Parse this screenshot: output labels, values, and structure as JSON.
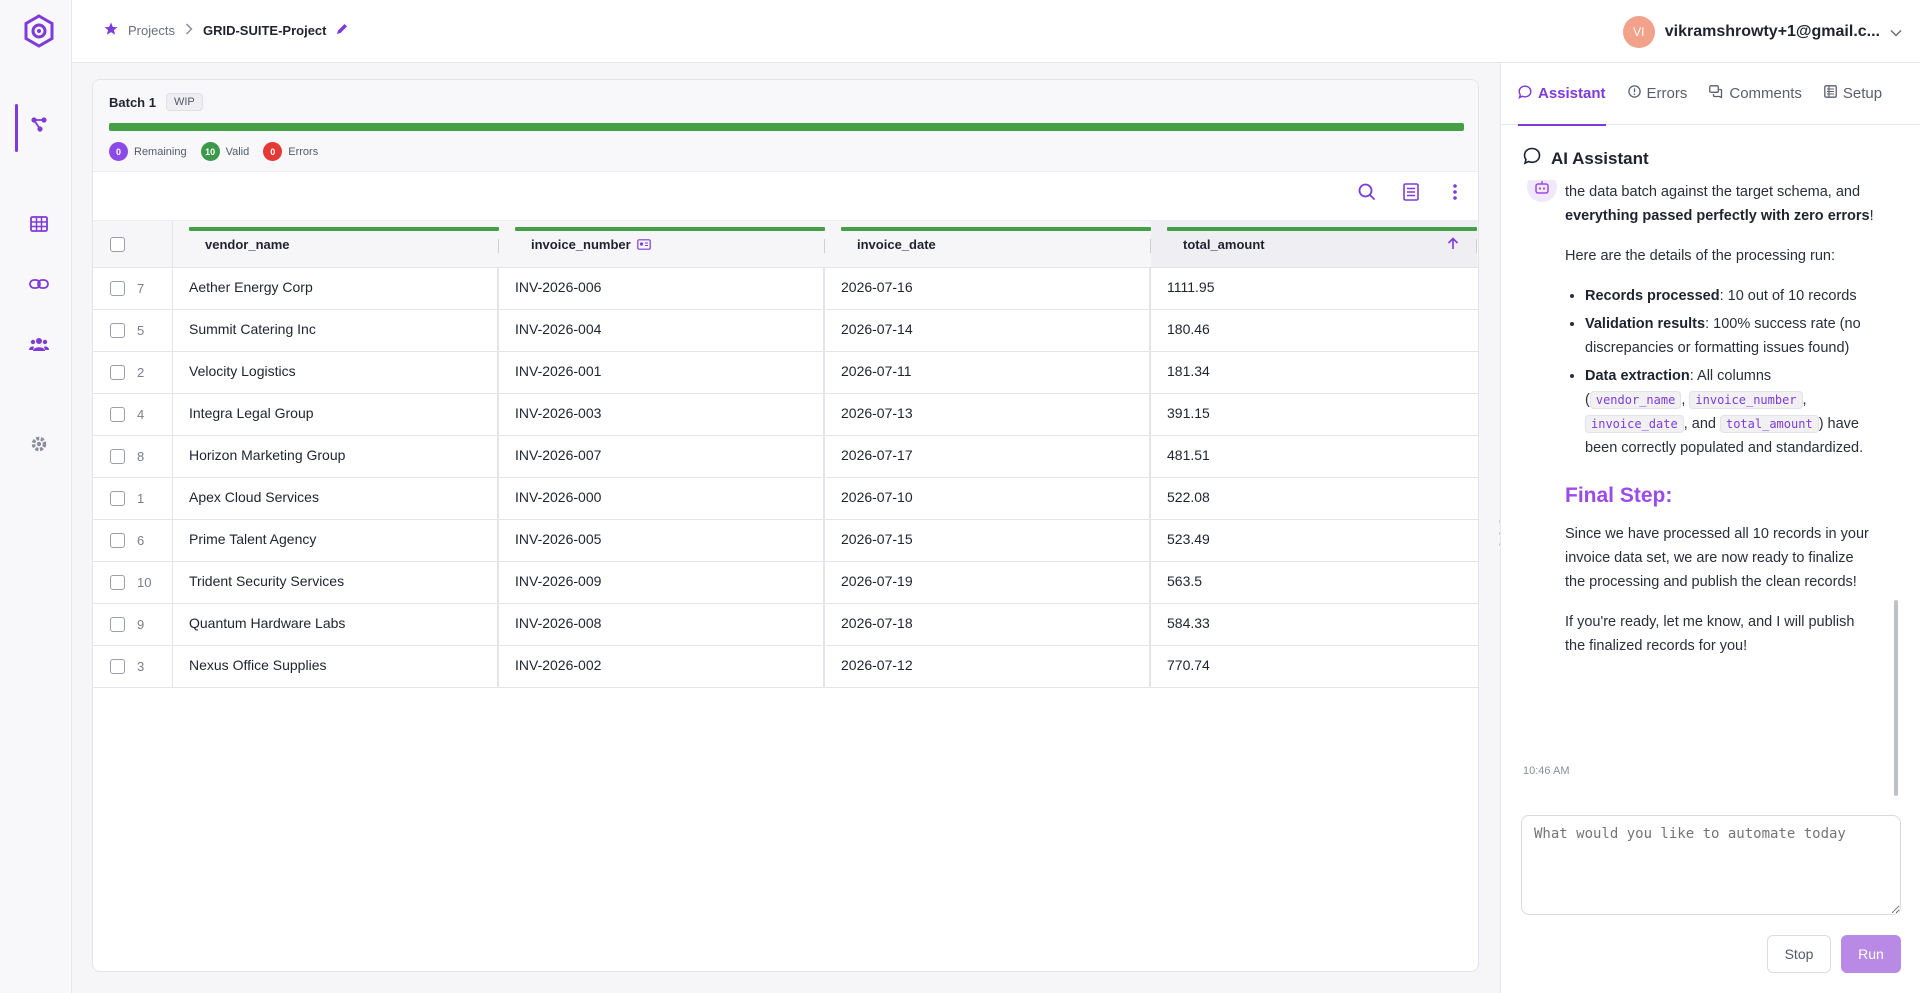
{
  "header": {
    "crumbs": {
      "projects": "Projects",
      "current": "GRID-SUITE-Project"
    },
    "user": {
      "initials": "VI",
      "name": "vikramshrowty+1@gmail.c..."
    }
  },
  "batch": {
    "title": "Batch 1",
    "status": "WIP",
    "progress_fraction": 1.0,
    "stats": {
      "remaining_count": "0",
      "remaining_label": "Remaining",
      "valid_count": "10",
      "valid_label": "Valid",
      "errors_count": "0",
      "errors_label": "Errors"
    }
  },
  "table": {
    "columns": [
      "vendor_name",
      "invoice_number",
      "invoice_date",
      "total_amount"
    ],
    "rows": [
      {
        "id": "7",
        "vendor_name": "Aether Energy Corp",
        "invoice_number": "INV-2026-006",
        "invoice_date": "2026-07-16",
        "total_amount": "1111.95"
      },
      {
        "id": "5",
        "vendor_name": "Summit Catering Inc",
        "invoice_number": "INV-2026-004",
        "invoice_date": "2026-07-14",
        "total_amount": "180.46"
      },
      {
        "id": "2",
        "vendor_name": "Velocity Logistics",
        "invoice_number": "INV-2026-001",
        "invoice_date": "2026-07-11",
        "total_amount": "181.34"
      },
      {
        "id": "4",
        "vendor_name": "Integra Legal Group",
        "invoice_number": "INV-2026-003",
        "invoice_date": "2026-07-13",
        "total_amount": "391.15"
      },
      {
        "id": "8",
        "vendor_name": "Horizon Marketing Group",
        "invoice_number": "INV-2026-007",
        "invoice_date": "2026-07-17",
        "total_amount": "481.51"
      },
      {
        "id": "1",
        "vendor_name": "Apex Cloud Services",
        "invoice_number": "INV-2026-000",
        "invoice_date": "2026-07-10",
        "total_amount": "522.08"
      },
      {
        "id": "6",
        "vendor_name": "Prime Talent Agency",
        "invoice_number": "INV-2026-005",
        "invoice_date": "2026-07-15",
        "total_amount": "523.49"
      },
      {
        "id": "10",
        "vendor_name": "Trident Security Services",
        "invoice_number": "INV-2026-009",
        "invoice_date": "2026-07-19",
        "total_amount": "563.5"
      },
      {
        "id": "9",
        "vendor_name": "Quantum Hardware Labs",
        "invoice_number": "INV-2026-008",
        "invoice_date": "2026-07-18",
        "total_amount": "584.33"
      },
      {
        "id": "3",
        "vendor_name": "Nexus Office Supplies",
        "invoice_number": "INV-2026-002",
        "invoice_date": "2026-07-12",
        "total_amount": "770.74"
      }
    ]
  },
  "panel": {
    "tabs": [
      "Assistant",
      "Errors",
      "Comments",
      "Setup"
    ],
    "ai_title": "AI Assistant",
    "msg": {
      "p1_a": "the data batch against the target schema, and ",
      "p1_b": "everything passed perfectly with zero errors",
      "p1_c": "!",
      "p2": "Here are the details of the processing run:",
      "li1_k": "Records processed",
      "li1_v": ": 10 out of 10 records",
      "li2_k": "Validation results",
      "li2_v": ": 100% success rate (no discrepancies or formatting issues found)",
      "li3_k": "Data extraction",
      "li3_v1": ": All columns (",
      "c1": "vendor_name",
      "c2": "invoice_number",
      "c3": "invoice_date",
      "and": ", and ",
      "c4": "total_amount",
      "li3_v2": ") have been correctly populated and standardized.",
      "final_title": "Final Step:",
      "p3": "Since we have processed all 10 records in your invoice data set, we are now ready to finalize the processing and publish the clean records!",
      "p4": "If you're ready, let me know, and I will publish the finalized records for you!"
    },
    "time": "10:46 AM",
    "input_placeholder": "What would you like to automate today",
    "stop_label": "Stop",
    "run_label": "Run"
  },
  "colors": {
    "accent": "#7e3bd9",
    "valid": "#43a047",
    "error": "#e53935"
  },
  "icons": [
    "logo-icon",
    "workflow-icon",
    "table-icon",
    "link-icon",
    "users-icon",
    "settings-icon",
    "star-icon",
    "chevron-right-icon",
    "pencil-icon",
    "chevron-down-icon",
    "search-icon",
    "export-icon",
    "more-vertical-icon",
    "arrow-up-icon",
    "chat-icon",
    "alert-icon",
    "comments-icon",
    "setup-icon",
    "bot-icon"
  ]
}
